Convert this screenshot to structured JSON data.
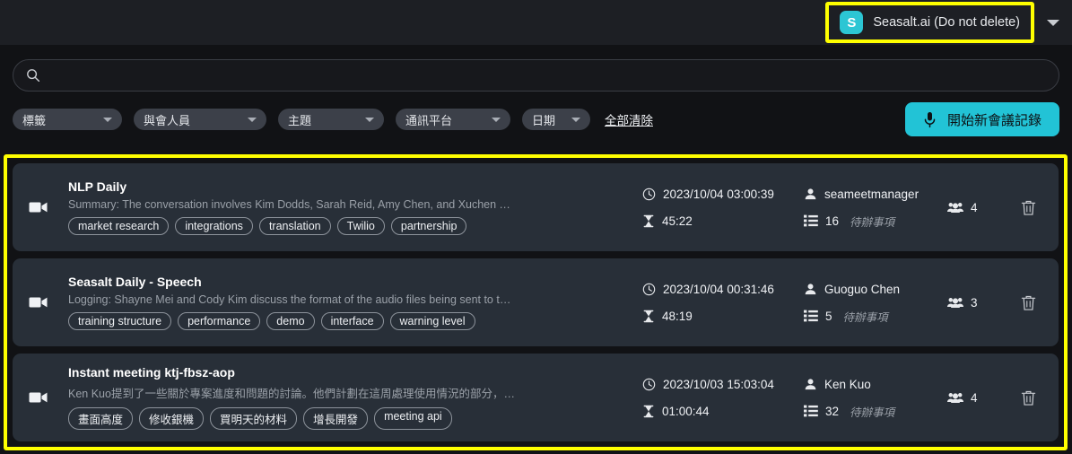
{
  "header": {
    "workspace_name": "Seasalt.ai (Do not delete)",
    "workspace_initial": "S",
    "accent_color": "#22c3d6",
    "highlight_color": "#ffff00"
  },
  "search": {
    "value": "",
    "placeholder": ""
  },
  "filters": {
    "pills": [
      {
        "label": "標籤"
      },
      {
        "label": "與會人員"
      },
      {
        "label": "主題"
      },
      {
        "label": "通訊平台"
      },
      {
        "label": "日期"
      }
    ],
    "clear_all_label": "全部清除",
    "new_recording_label": "開始新會議記錄"
  },
  "meetings": [
    {
      "title": "NLP Daily",
      "summary": "Summary: The conversation involves Kim Dodds, Sarah Reid, Amy Chen, and Xuchen Yao di…",
      "tags": [
        "market research",
        "integrations",
        "translation",
        "Twilio",
        "partnership"
      ],
      "datetime": "2023/10/04 03:00:39",
      "duration": "45:22",
      "host": "seameetmanager",
      "todo_count": "16",
      "todo_label": "待辦事項",
      "participants": "4"
    },
    {
      "title": "Seasalt Daily - Speech",
      "summary": "Logging: Shayne Mei and Cody Kim discuss the format of the audio files being sent to the s…",
      "tags": [
        "training structure",
        "performance",
        "demo",
        "interface",
        "warning level"
      ],
      "datetime": "2023/10/04 00:31:46",
      "duration": "48:19",
      "host": "Guoguo Chen",
      "todo_count": "5",
      "todo_label": "待辦事項",
      "participants": "3"
    },
    {
      "title": "Instant meeting ktj-fbsz-aop",
      "summary": "Ken Kuo提到了一些關於專案進度和問題的討論。他們計劃在這周處理使用情況的部分，並…",
      "tags": [
        "畫面高度",
        "修收銀機",
        "買明天的材料",
        "增長開發",
        "meeting api"
      ],
      "datetime": "2023/10/03 15:03:04",
      "duration": "01:00:44",
      "host": "Ken Kuo",
      "todo_count": "32",
      "todo_label": "待辦事項",
      "participants": "4"
    }
  ]
}
